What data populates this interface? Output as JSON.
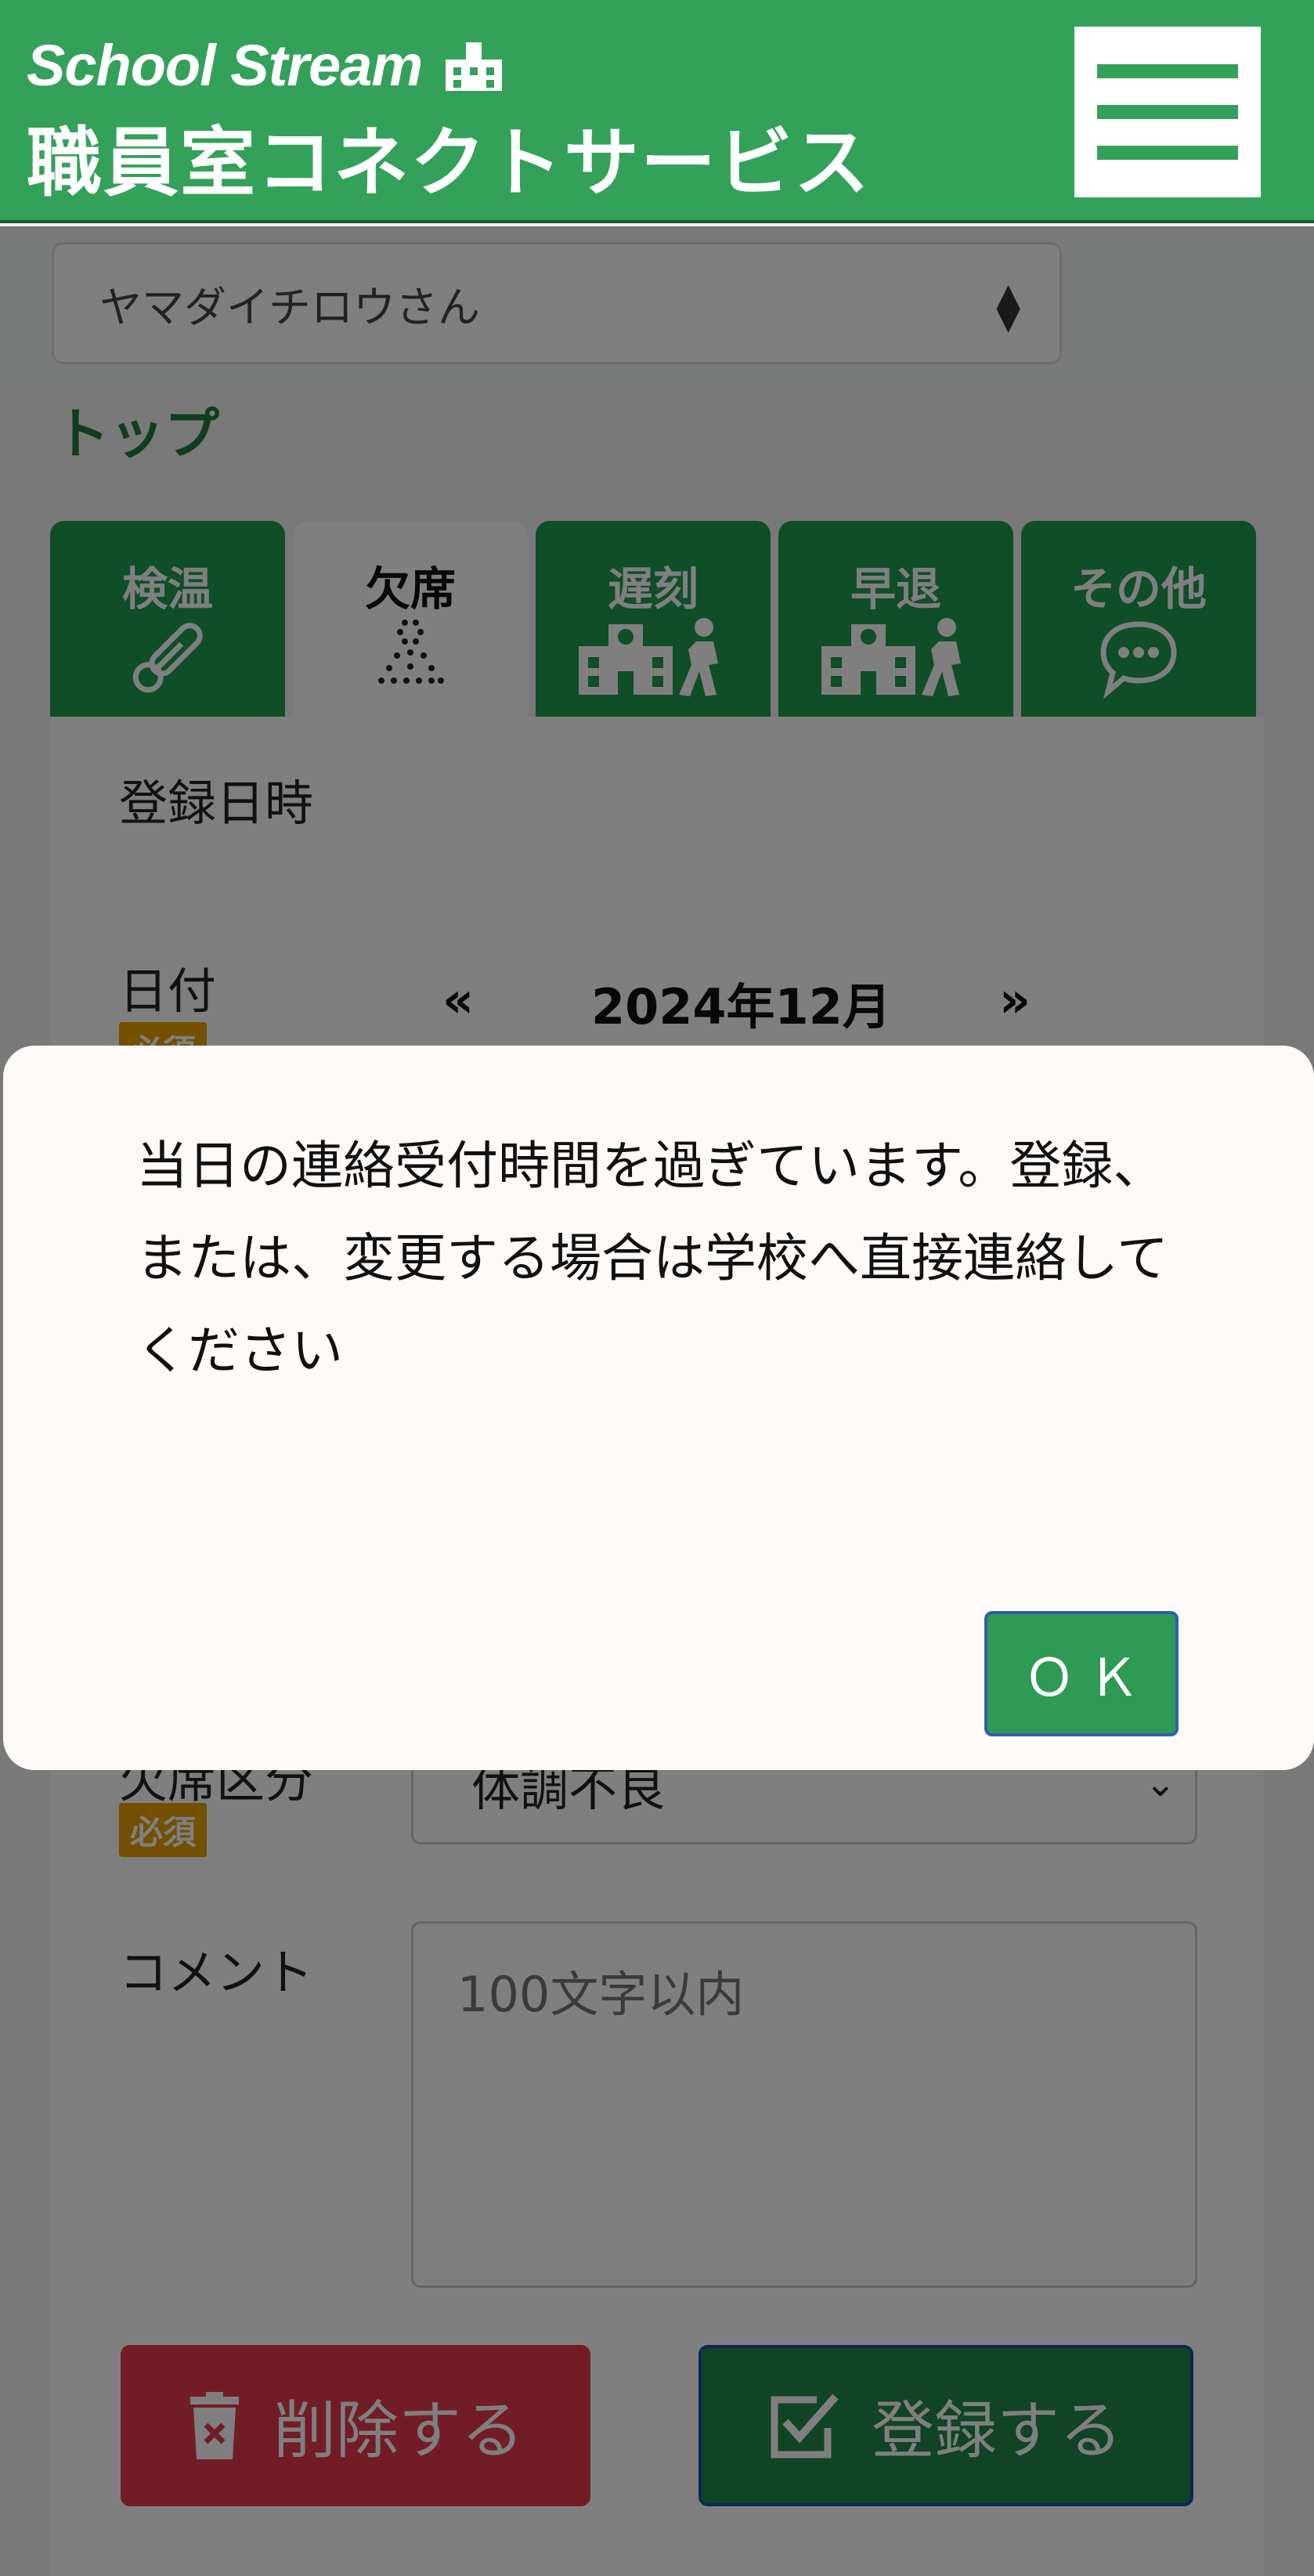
{
  "header": {
    "brand": "School Stream",
    "service_name": "職員室コネクトサービス"
  },
  "student_select": {
    "value": "ヤマダイチロウさん"
  },
  "page_title": "トップ",
  "tabs": [
    {
      "label": "検温",
      "icon": "thermometer-icon",
      "active": false
    },
    {
      "label": "欠席",
      "icon": "absence-dots-icon",
      "active": true
    },
    {
      "label": "遅刻",
      "icon": "school-walker-icon",
      "active": false
    },
    {
      "label": "早退",
      "icon": "school-walker-icon",
      "active": false
    },
    {
      "label": "その他",
      "icon": "speech-bubble-icon",
      "active": false
    }
  ],
  "form": {
    "registered_at_label": "登録日時",
    "date_label": "日付",
    "required_badge": "必須",
    "month_prev": "«",
    "month_current": "2024年12月",
    "month_next": "»",
    "reason_label": "欠席区分",
    "reason_value": "体調不良",
    "comment_label": "コメント",
    "comment_placeholder": "100文字以内",
    "delete_button": "削除する",
    "register_button": "登録する"
  },
  "modal": {
    "message": "当日の連絡受付時間を過ぎています。登録、または、変更する場合は学校へ直接連絡してください",
    "ok_button": "ＯＫ"
  },
  "colors": {
    "brand_green": "#34a15a",
    "tab_green": "#1f9c4e",
    "required_orange": "#e5a000",
    "delete_red": "#e53b4b"
  }
}
